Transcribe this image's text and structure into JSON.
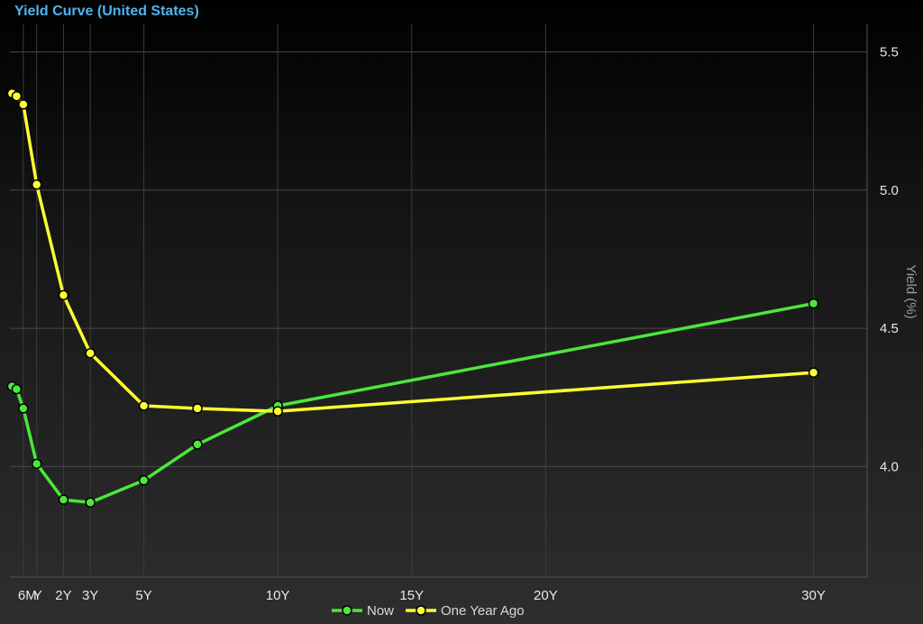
{
  "chart_data": {
    "type": "line",
    "title": "Yield Curve (United States)",
    "ylabel": "Yield (%)",
    "xlabel": "",
    "ylim": [
      3.6,
      5.6
    ],
    "xlim": [
      0,
      32
    ],
    "y_ticks": [
      4.0,
      4.5,
      5.0,
      5.5
    ],
    "x_ticks": [
      {
        "value": 0.5,
        "label": "6M"
      },
      {
        "value": 1,
        "label": "Y"
      },
      {
        "value": 2,
        "label": "2Y"
      },
      {
        "value": 3,
        "label": "3Y"
      },
      {
        "value": 5,
        "label": "5Y"
      },
      {
        "value": 10,
        "label": "10Y"
      },
      {
        "value": 15,
        "label": "15Y"
      },
      {
        "value": 20,
        "label": "20Y"
      },
      {
        "value": 30,
        "label": "30Y"
      }
    ],
    "grid": true,
    "legend_position": "bottom-center",
    "series": [
      {
        "name": "Now",
        "color": "#4ce63c",
        "x": [
          0.08,
          0.25,
          0.5,
          1,
          2,
          3,
          5,
          7,
          10,
          30
        ],
        "y": [
          4.29,
          4.28,
          4.21,
          4.01,
          3.88,
          3.87,
          3.95,
          4.08,
          4.22,
          4.59
        ]
      },
      {
        "name": "One Year Ago",
        "color": "#ffff33",
        "x": [
          0.08,
          0.25,
          0.5,
          1,
          2,
          3,
          5,
          7,
          10,
          30
        ],
        "y": [
          5.35,
          5.34,
          5.31,
          5.02,
          4.62,
          4.41,
          4.22,
          4.21,
          4.2,
          4.34
        ]
      }
    ]
  }
}
